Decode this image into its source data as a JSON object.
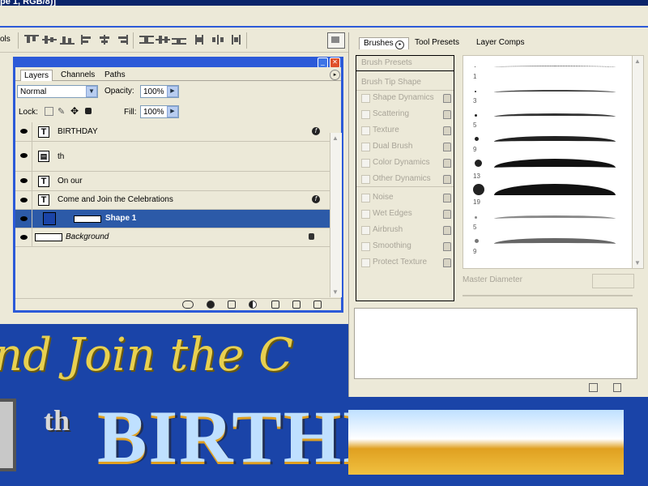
{
  "window": {
    "title_fragment": "pe 1, RGB/8)]"
  },
  "toolbar": {
    "left_label": "ols"
  },
  "layers_panel": {
    "tabs": [
      "Layers",
      "Channels",
      "Paths"
    ],
    "blend_mode": "Normal",
    "opacity_label": "Opacity:",
    "opacity_value": "100%",
    "lock_label": "Lock:",
    "fill_label": "Fill:",
    "fill_value": "100%",
    "layers": [
      {
        "name": "BIRTHDAY",
        "type": "text",
        "has_fx": true
      },
      {
        "name": "th",
        "type": "smart"
      },
      {
        "name": "On our",
        "type": "text"
      },
      {
        "name": "Come and Join the Celebrations",
        "type": "text",
        "has_fx": true
      },
      {
        "name": "Shape 1",
        "type": "shape",
        "selected": true
      },
      {
        "name": "Background",
        "type": "background",
        "locked": true
      }
    ]
  },
  "brushes_panel": {
    "tabs": [
      "Brushes",
      "Tool Presets",
      "Layer Comps"
    ],
    "options": [
      "Brush Presets",
      "Brush Tip Shape",
      "Shape Dynamics",
      "Scattering",
      "Texture",
      "Dual Brush",
      "Color Dynamics",
      "Other Dynamics",
      "Noise",
      "Wet Edges",
      "Airbrush",
      "Smoothing",
      "Protect Texture"
    ],
    "brush_sizes": [
      "1",
      "3",
      "5",
      "9",
      "13",
      "19",
      "5",
      "9"
    ],
    "master_diameter_label": "Master Diameter"
  },
  "canvas": {
    "script_text": "nd Join the C",
    "big_text": "BIRTHDAY",
    "superscript": "th"
  }
}
